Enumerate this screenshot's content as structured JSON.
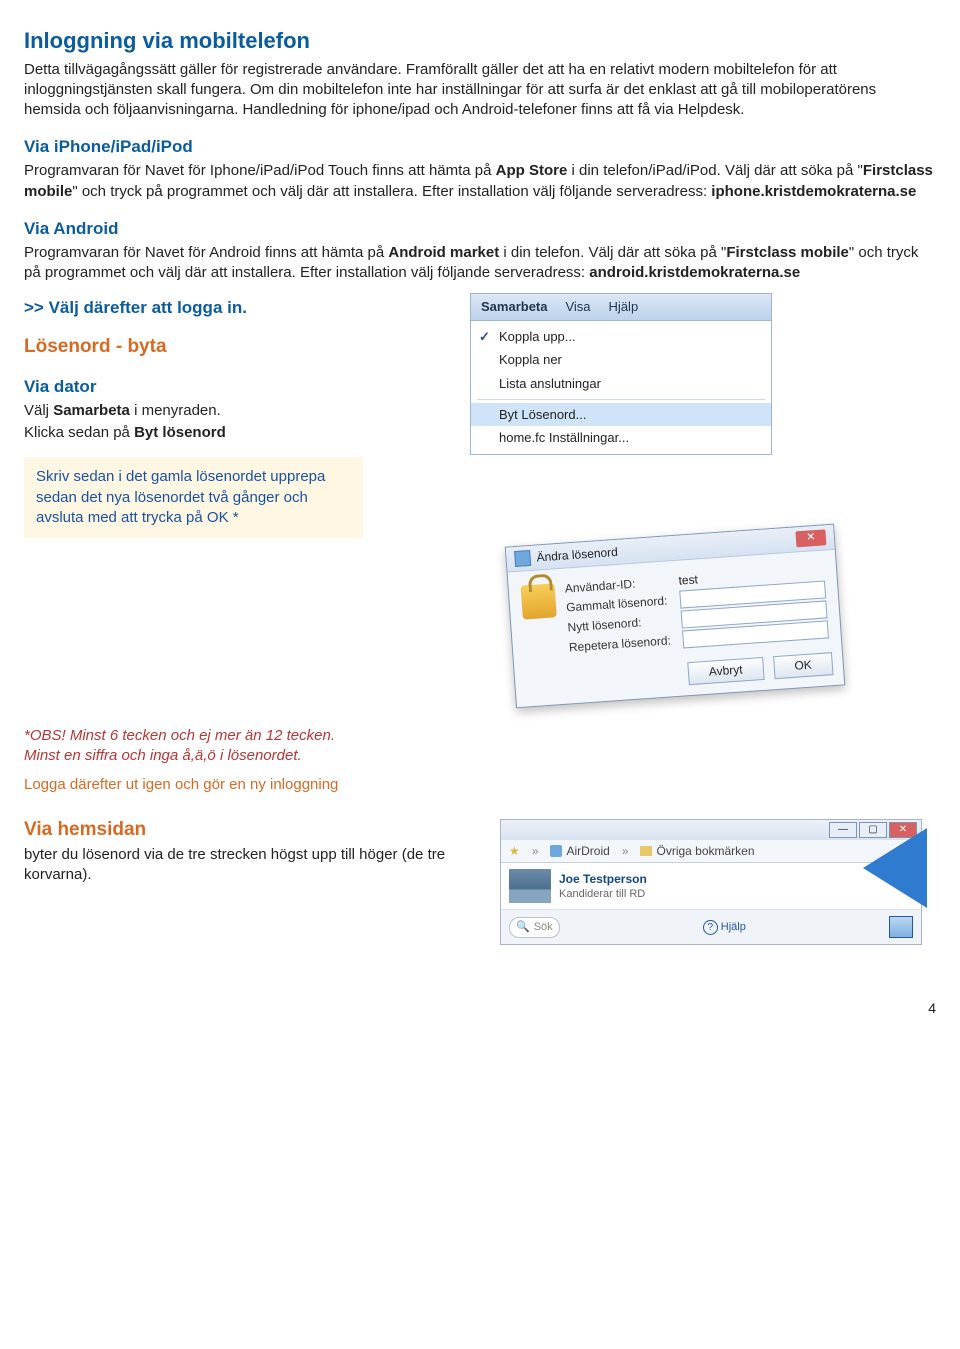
{
  "h_login_mobile": "Inloggning via mobiltelefon",
  "p_login_mobile": "Detta tillvägagångssätt gäller för registrerade användare. Framförallt gäller det att ha en relativt modern mobiltelefon för att inloggningstjänsten skall fungera. Om din mobiltelefon inte har inställningar för att surfa är det enklast att gå till mobiloperatörens hemsida och följaanvisningarna. Handledning för iphone/ipad och Android-telefoner finns att få via Helpdesk.",
  "h_iphone": "Via iPhone/iPad/iPod",
  "p_iphone_1": "Programvaran för Navet för Iphone/iPad/iPod Touch finns att hämta på ",
  "p_iphone_b1": "App Store",
  "p_iphone_2": " i din telefon/iPad/iPod. Välj där att söka på \"",
  "p_iphone_b2": "Firstclass mobile",
  "p_iphone_3": "\" och tryck på programmet och välj där att installera. Efter installation välj följande serveradress: ",
  "p_iphone_b3": "iphone.kristdemokraterna.se",
  "h_android": "Via Android",
  "p_android_1": "Programvaran för Navet för Android finns att hämta på ",
  "p_android_b1": "Android market",
  "p_android_2": " i din telefon. Välj där att söka på \"",
  "p_android_b2": "Firstclass mobile",
  "p_android_3": "\" och tryck på programmet och välj där att installera. Efter installation välj följande serveradress: ",
  "p_android_b3": "android.kristdemokraterna.se",
  "prompt_login": ">> Välj därefter att logga in.",
  "h_losen": "Lösenord - byta",
  "h_viadator": "Via dator",
  "p_viadator_1": "Välj ",
  "p_viadator_b1": "Samarbeta",
  "p_viadator_2": " i menyraden.",
  "p_viadator_3": "Klicka sedan på ",
  "p_viadator_b2": "Byt lösenord",
  "tip_box": "Skriv sedan i det gamla lösenordet upprepa sedan det nya lösenordet två gånger och avsluta med att trycka på OK *",
  "menu": {
    "bar": [
      "Samarbeta",
      "Visa",
      "Hjälp"
    ],
    "items": [
      {
        "label": "Koppla upp...",
        "check": true
      },
      {
        "label": "Koppla ner"
      },
      {
        "label": "Lista anslutningar"
      },
      {
        "sep": true
      },
      {
        "label": "Byt Lösenord...",
        "sel": true
      },
      {
        "label": "home.fc Inställningar..."
      }
    ]
  },
  "dlg": {
    "title": "Ändra lösenord",
    "user_label": "Användar-ID:",
    "user_val": "test",
    "old": "Gammalt lösenord:",
    "new": "Nytt lösenord:",
    "rep": "Repetera lösenord:",
    "cancel": "Avbryt",
    "ok": "OK"
  },
  "obs1": "*OBS!  Minst 6 tecken och ej mer än 12 tecken.",
  "obs2": "Minst en siffra och inga å,ä,ö i lösenordet.",
  "logout": "Logga därefter ut igen och gör en ny inloggning",
  "h_hemsida": "Via hemsidan",
  "p_hemsida": "byter du lösenord via de tre strecken högst upp till höger (de tre korvarna).",
  "browser": {
    "bm1": "AirDroid",
    "bm2": "Övriga bokmärken",
    "name": "Joe Testperson",
    "sub": "Kandiderar till RD",
    "search": "Sök",
    "help": "Hjälp"
  },
  "page_num": "4"
}
